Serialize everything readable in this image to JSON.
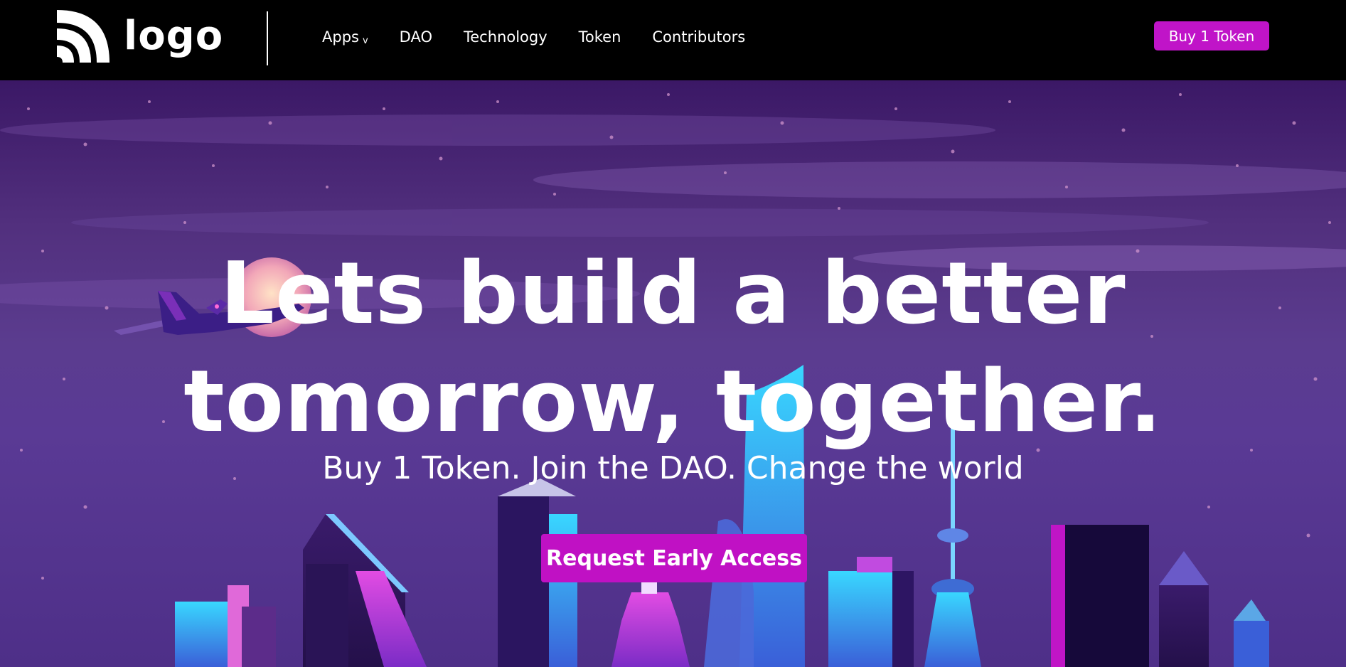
{
  "nav": {
    "logo_text": "logo",
    "links": [
      "Apps",
      "DAO",
      "Technology",
      "Token",
      "Contributors"
    ],
    "apps_caret": "v",
    "buy_button": "Buy 1 Token"
  },
  "hero": {
    "headline_line1": "Lets build a better",
    "headline_line2": "tomorrow, together.",
    "subheadline": "Buy 1 Token. Join the DAO. Change the world",
    "cta_button": "Request Early Access"
  },
  "colors": {
    "accent": "#c014c8",
    "nav_background": "#000000",
    "hero_purple": "#5a3a95"
  },
  "icons": [
    "logo-icon",
    "chevron-down-icon",
    "airplane-illustration",
    "city-skyline-illustration"
  ]
}
